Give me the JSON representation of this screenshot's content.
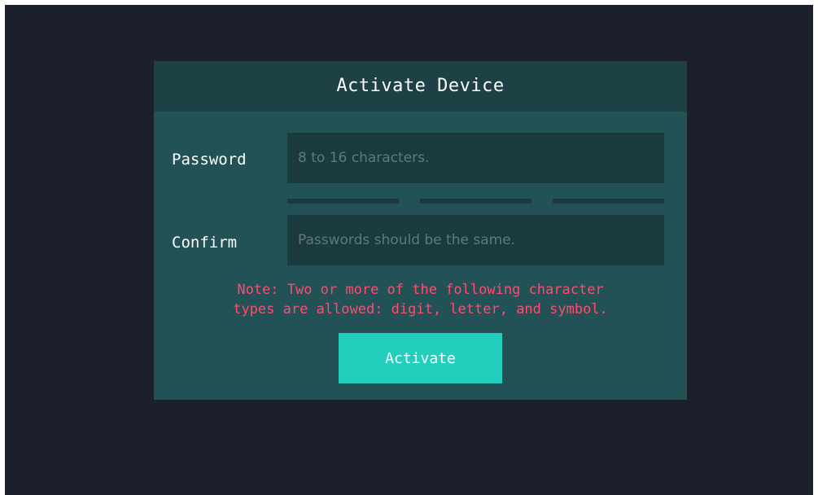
{
  "dialog": {
    "title": "Activate Device",
    "password": {
      "label": "Password",
      "placeholder": "8 to 16 characters.",
      "value": ""
    },
    "password_strength_segments": 3,
    "confirm": {
      "label": "Confirm",
      "placeholder": "Passwords should be the same.",
      "value": ""
    },
    "note_line1": "Note: Two or more of the following character",
    "note_line2": "types are allowed: digit, letter, and symbol.",
    "activate_label": "Activate"
  },
  "colors": {
    "background": "#1b202a",
    "dialog_body": "#225256",
    "dialog_header": "#1d4145",
    "input_background": "#1b3a3d",
    "note_text": "#ff4d6f",
    "primary_button": "#22cfbd"
  }
}
